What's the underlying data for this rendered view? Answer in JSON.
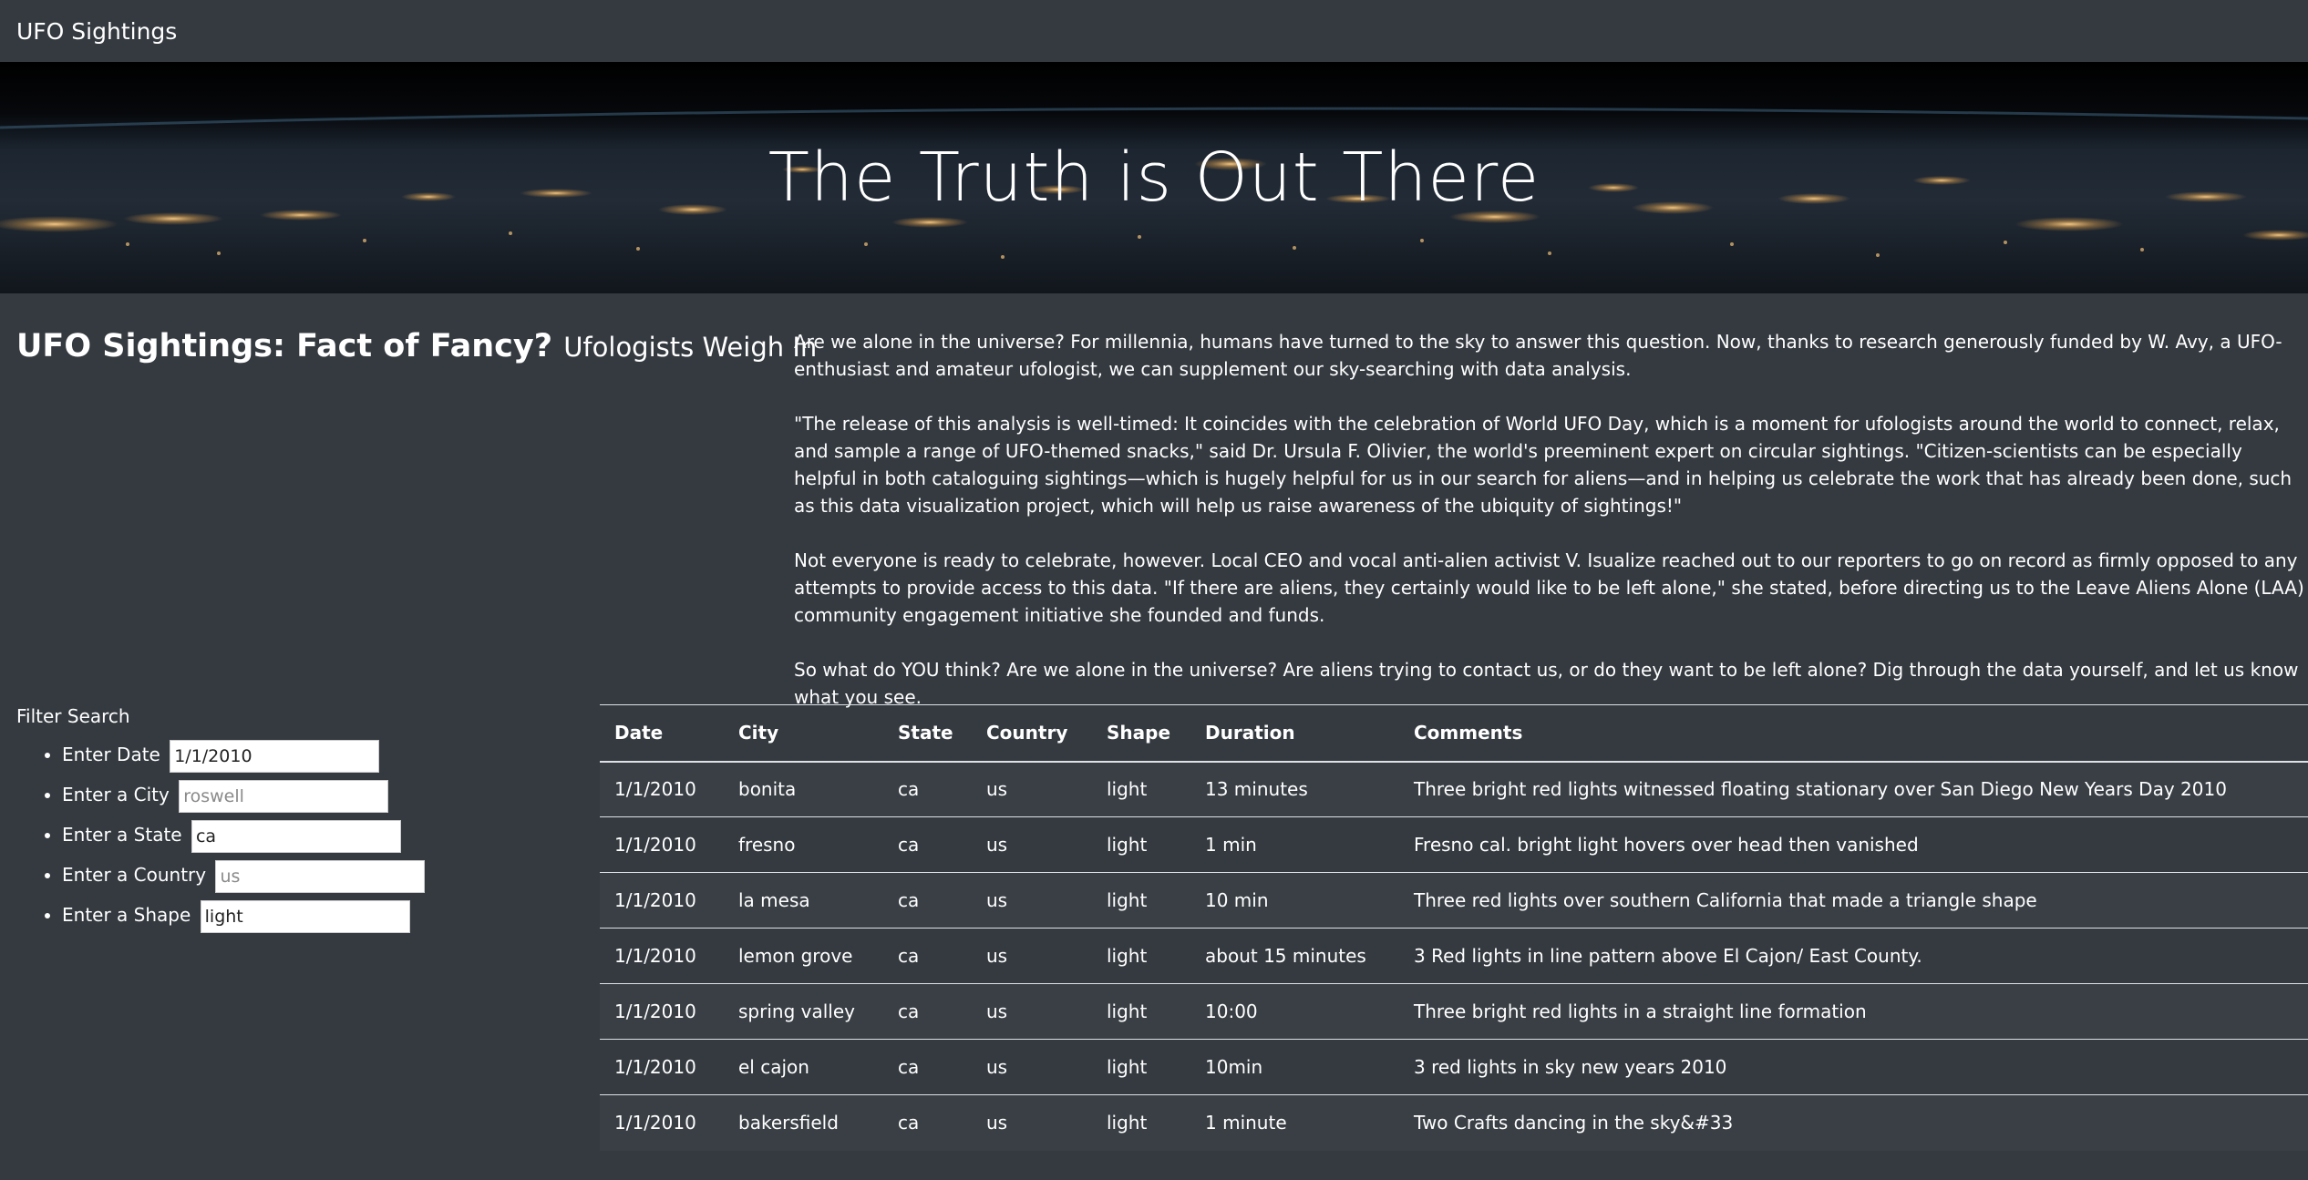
{
  "nav": {
    "brand": "UFO Sightings"
  },
  "hero": {
    "title": "The Truth is Out There"
  },
  "article": {
    "title": "UFO Sightings: Fact of Fancy?",
    "subtitle": "Ufologists Weigh In",
    "paragraphs": [
      "Are we alone in the universe? For millennia, humans have turned to the sky to answer this question. Now, thanks to research generously funded by W. Avy, a UFO-enthusiast and amateur ufologist, we can supplement our sky-searching with data analysis.",
      "\"The release of this analysis is well-timed: It coincides with the celebration of World UFO Day, which is a moment for ufologists around the world to connect, relax, and sample a range of UFO-themed snacks,\" said Dr. Ursula F. Olivier, the world's preeminent expert on circular sightings. \"Citizen-scientists can be especially helpful in both cataloguing sightings—which is hugely helpful for us in our search for aliens—and in helping us celebrate the work that has already been done, such as this data visualization project, which will help us raise awareness of the ubiquity of sightings!\"",
      "Not everyone is ready to celebrate, however. Local CEO and vocal anti-alien activist V. Isualize reached out to our reporters to go on record as firmly opposed to any attempts to provide access to this data. \"If there are aliens, they certainly would like to be left alone,\" she stated, before directing us to the Leave Aliens Alone (LAA) community engagement initiative she founded and funds.",
      "So what do YOU think? Are we alone in the universe? Are aliens trying to contact us, or do they want to be left alone? Dig through the data yourself, and let us know what you see."
    ]
  },
  "filters": {
    "title": "Filter Search",
    "items": [
      {
        "label": "Enter Date",
        "value": "1/1/2010",
        "placeholder": ""
      },
      {
        "label": "Enter a City",
        "value": "",
        "placeholder": "roswell"
      },
      {
        "label": "Enter a State",
        "value": "ca",
        "placeholder": ""
      },
      {
        "label": "Enter a Country",
        "value": "",
        "placeholder": "us"
      },
      {
        "label": "Enter a Shape",
        "value": "light",
        "placeholder": ""
      }
    ]
  },
  "table": {
    "headers": [
      "Date",
      "City",
      "State",
      "Country",
      "Shape",
      "Duration",
      "Comments"
    ],
    "rows": [
      [
        "1/1/2010",
        "bonita",
        "ca",
        "us",
        "light",
        "13 minutes",
        "Three bright red lights witnessed floating stationary over San Diego New Years Day 2010"
      ],
      [
        "1/1/2010",
        "fresno",
        "ca",
        "us",
        "light",
        "1 min",
        "Fresno cal. bright light hovers over head then vanished"
      ],
      [
        "1/1/2010",
        "la mesa",
        "ca",
        "us",
        "light",
        "10 min",
        "Three red lights over southern California that made a triangle shape"
      ],
      [
        "1/1/2010",
        "lemon grove",
        "ca",
        "us",
        "light",
        "about 15 minutes",
        "3 Red lights in line pattern above El Cajon/ East County."
      ],
      [
        "1/1/2010",
        "spring valley",
        "ca",
        "us",
        "light",
        "10:00",
        "Three bright red lights in a straight line formation"
      ],
      [
        "1/1/2010",
        "el cajon",
        "ca",
        "us",
        "light",
        "10min",
        "3 red lights in sky new years 2010"
      ],
      [
        "1/1/2010",
        "bakersfield",
        "ca",
        "us",
        "light",
        "1 minute",
        "Two Crafts dancing in the sky&#33"
      ]
    ]
  }
}
